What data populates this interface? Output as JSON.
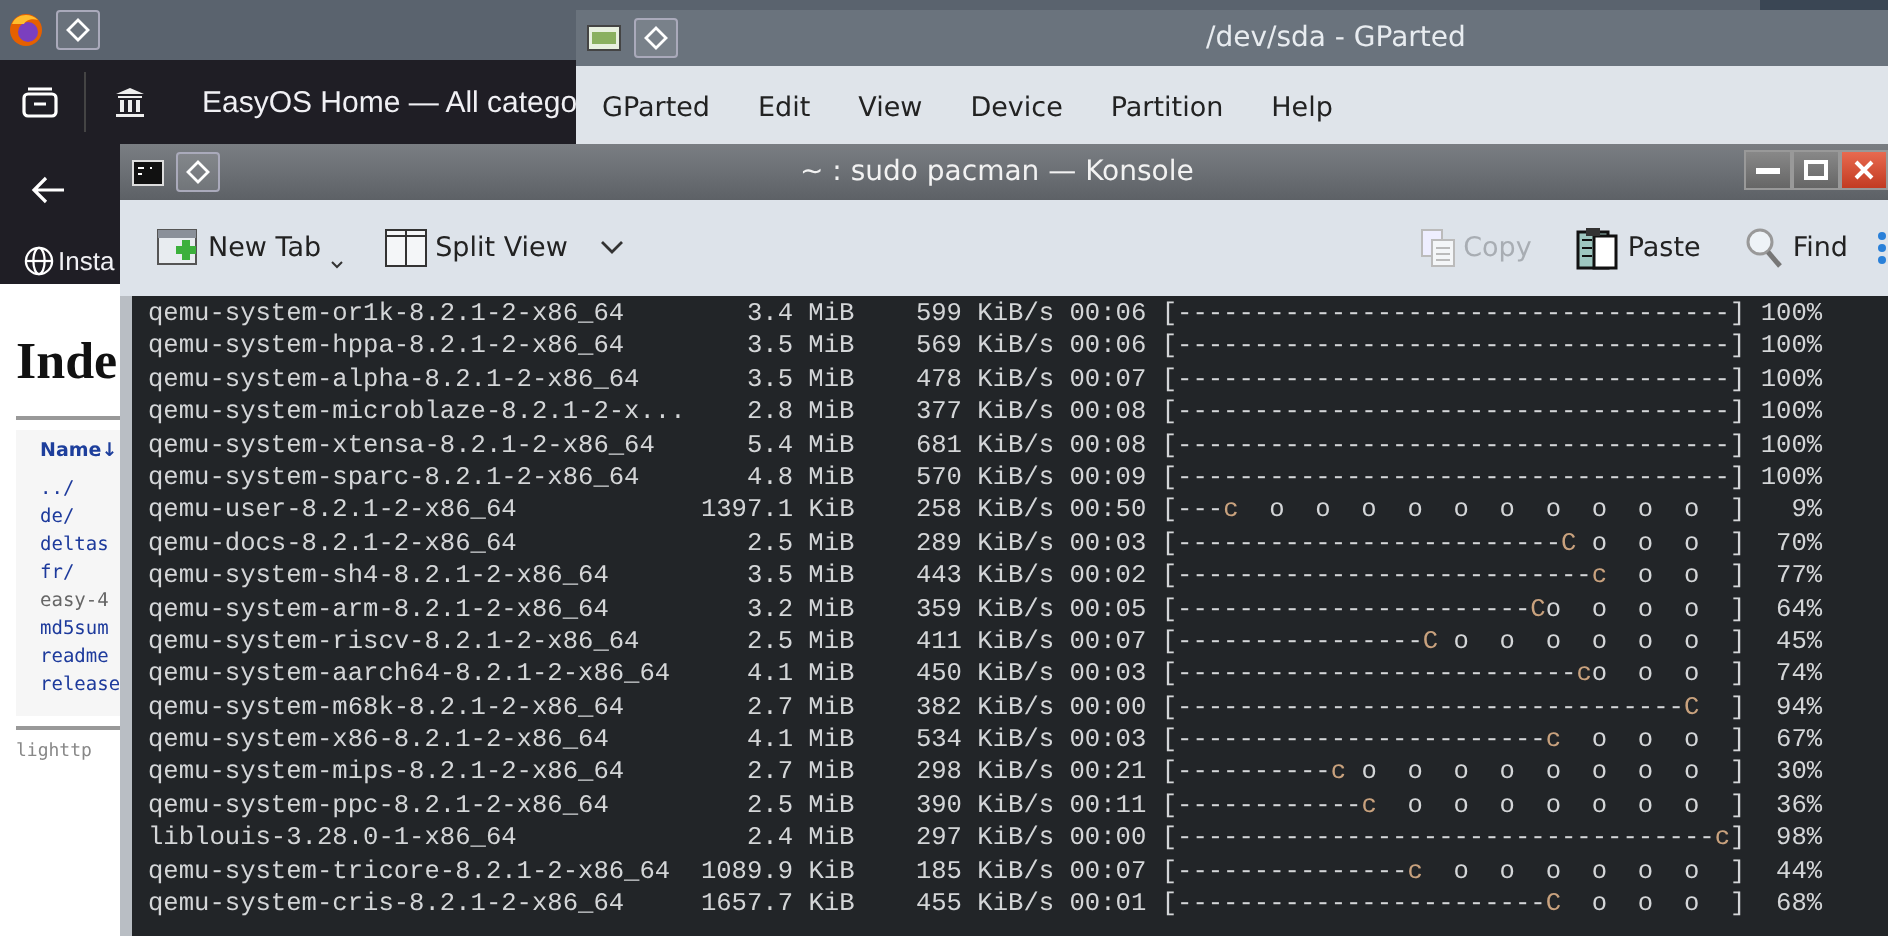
{
  "browser_window": {
    "tab_title": "EasyOS Home — All catego",
    "bookmark": "Insta",
    "page": {
      "heading": "Inde",
      "column_header": "Name↓",
      "entries": [
        {
          "text": "../",
          "kind": "link"
        },
        {
          "text": "de/",
          "kind": "link"
        },
        {
          "text": "deltas",
          "kind": "link"
        },
        {
          "text": "fr/",
          "kind": "link"
        },
        {
          "text": "easy-4",
          "kind": "plain"
        },
        {
          "text": "md5sum",
          "kind": "link"
        },
        {
          "text": "readme",
          "kind": "link"
        },
        {
          "text": "release",
          "kind": "link"
        }
      ],
      "footer": "lighttp"
    }
  },
  "gparted_window": {
    "title": "/dev/sda - GParted",
    "menu": [
      "GParted",
      "Edit",
      "View",
      "Device",
      "Partition",
      "Help"
    ]
  },
  "konsole_window": {
    "title": "~ : sudo pacman — Konsole",
    "toolbar": [
      {
        "label": "New Tab",
        "kind": "new-tab",
        "disabled": false
      },
      {
        "label": "Split View",
        "kind": "split-view",
        "disabled": false
      },
      {
        "label": "Copy",
        "kind": "copy",
        "disabled": true
      },
      {
        "label": "Paste",
        "kind": "paste",
        "disabled": false
      },
      {
        "label": "Find",
        "kind": "find",
        "disabled": false
      }
    ],
    "lines": [
      {
        "name": "qemu-system-or1k-8.2.1-2-x86_64",
        "size": "3.4 MiB",
        "speed": "599 KiB/s",
        "eta": "00:06",
        "bar": {
          "trail": "[------------------------------------]"
        },
        "percent": "100%"
      },
      {
        "name": "qemu-system-hppa-8.2.1-2-x86_64",
        "size": "3.5 MiB",
        "speed": "569 KiB/s",
        "eta": "00:06",
        "bar": {
          "trail": "[------------------------------------]"
        },
        "percent": "100%"
      },
      {
        "name": "qemu-system-alpha-8.2.1-2-x86_64",
        "size": "3.5 MiB",
        "speed": "478 KiB/s",
        "eta": "00:07",
        "bar": {
          "trail": "[------------------------------------]"
        },
        "percent": "100%"
      },
      {
        "name": "qemu-system-microblaze-8.2.1-2-x...",
        "size": "2.8 MiB",
        "speed": "377 KiB/s",
        "eta": "00:08",
        "bar": {
          "trail": "[------------------------------------]"
        },
        "percent": "100%"
      },
      {
        "name": "qemu-system-xtensa-8.2.1-2-x86_64",
        "size": "5.4 MiB",
        "speed": "681 KiB/s",
        "eta": "00:08",
        "bar": {
          "trail": "[------------------------------------]"
        },
        "percent": "100%"
      },
      {
        "name": "qemu-system-sparc-8.2.1-2-x86_64",
        "size": "4.8 MiB",
        "speed": "570 KiB/s",
        "eta": "00:09",
        "bar": {
          "trail": "[------------------------------------]"
        },
        "percent": "100%"
      },
      {
        "name": "qemu-user-8.2.1-2-x86_64",
        "size": "1397.1 KiB",
        "speed": "258 KiB/s",
        "eta": "00:50",
        "bar": {
          "trail": "[---",
          "pacman": "c",
          "ahead": "  o  o  o  o  o  o  o  o  o  o  ]"
        },
        "percent": "9%"
      },
      {
        "name": "qemu-docs-8.2.1-2-x86_64",
        "size": "2.5 MiB",
        "speed": "289 KiB/s",
        "eta": "00:03",
        "bar": {
          "trail": "[-------------------------",
          "pacman": "C",
          "ahead": " o  o  o  ]"
        },
        "percent": "70%"
      },
      {
        "name": "qemu-system-sh4-8.2.1-2-x86_64",
        "size": "3.5 MiB",
        "speed": "443 KiB/s",
        "eta": "00:02",
        "bar": {
          "trail": "[---------------------------",
          "pacman": "c",
          "ahead": "  o  o  ]"
        },
        "percent": "77%"
      },
      {
        "name": "qemu-system-arm-8.2.1-2-x86_64",
        "size": "3.2 MiB",
        "speed": "359 KiB/s",
        "eta": "00:05",
        "bar": {
          "trail": "[-----------------------",
          "pacman": "C",
          "ahead": "o  o  o  o  ]"
        },
        "percent": "64%"
      },
      {
        "name": "qemu-system-riscv-8.2.1-2-x86_64",
        "size": "2.5 MiB",
        "speed": "411 KiB/s",
        "eta": "00:07",
        "bar": {
          "trail": "[----------------",
          "pacman": "C",
          "ahead": " o  o  o  o  o  o  ]"
        },
        "percent": "45%"
      },
      {
        "name": "qemu-system-aarch64-8.2.1-2-x86_64",
        "size": "4.1 MiB",
        "speed": "450 KiB/s",
        "eta": "00:03",
        "bar": {
          "trail": "[--------------------------",
          "pacman": "c",
          "ahead": "o  o  o  ]"
        },
        "percent": "74%"
      },
      {
        "name": "qemu-system-m68k-8.2.1-2-x86_64",
        "size": "2.7 MiB",
        "speed": "382 KiB/s",
        "eta": "00:00",
        "bar": {
          "trail": "[---------------------------------",
          "pacman": "C",
          "ahead": "  ]"
        },
        "percent": "94%"
      },
      {
        "name": "qemu-system-x86-8.2.1-2-x86_64",
        "size": "4.1 MiB",
        "speed": "534 KiB/s",
        "eta": "00:03",
        "bar": {
          "trail": "[------------------------",
          "pacman": "c",
          "ahead": "  o  o  o  ]"
        },
        "percent": "67%"
      },
      {
        "name": "qemu-system-mips-8.2.1-2-x86_64",
        "size": "2.7 MiB",
        "speed": "298 KiB/s",
        "eta": "00:21",
        "bar": {
          "trail": "[----------",
          "pacman": "c",
          "ahead": " o  o  o  o  o  o  o  o  ]"
        },
        "percent": "30%"
      },
      {
        "name": "qemu-system-ppc-8.2.1-2-x86_64",
        "size": "2.5 MiB",
        "speed": "390 KiB/s",
        "eta": "00:11",
        "bar": {
          "trail": "[------------",
          "pacman": "c",
          "ahead": "  o  o  o  o  o  o  o  ]"
        },
        "percent": "36%"
      },
      {
        "name": "liblouis-3.28.0-1-x86_64",
        "size": "2.4 MiB",
        "speed": "297 KiB/s",
        "eta": "00:00",
        "bar": {
          "trail": "[-----------------------------------",
          "pacman": "c",
          "ahead": "]"
        },
        "percent": "98%"
      },
      {
        "name": "qemu-system-tricore-8.2.1-2-x86_64",
        "size": "1089.9 KiB",
        "speed": "185 KiB/s",
        "eta": "00:07",
        "bar": {
          "trail": "[---------------",
          "pacman": "c",
          "ahead": "  o  o  o  o  o  o  ]"
        },
        "percent": "44%"
      },
      {
        "name": "qemu-system-cris-8.2.1-2-x86_64",
        "size": "1657.7 KiB",
        "speed": "455 KiB/s",
        "eta": "00:01",
        "bar": {
          "trail": "[------------------------",
          "pacman": "C",
          "ahead": "  o  o  o  ]"
        },
        "percent": "68%"
      }
    ]
  }
}
